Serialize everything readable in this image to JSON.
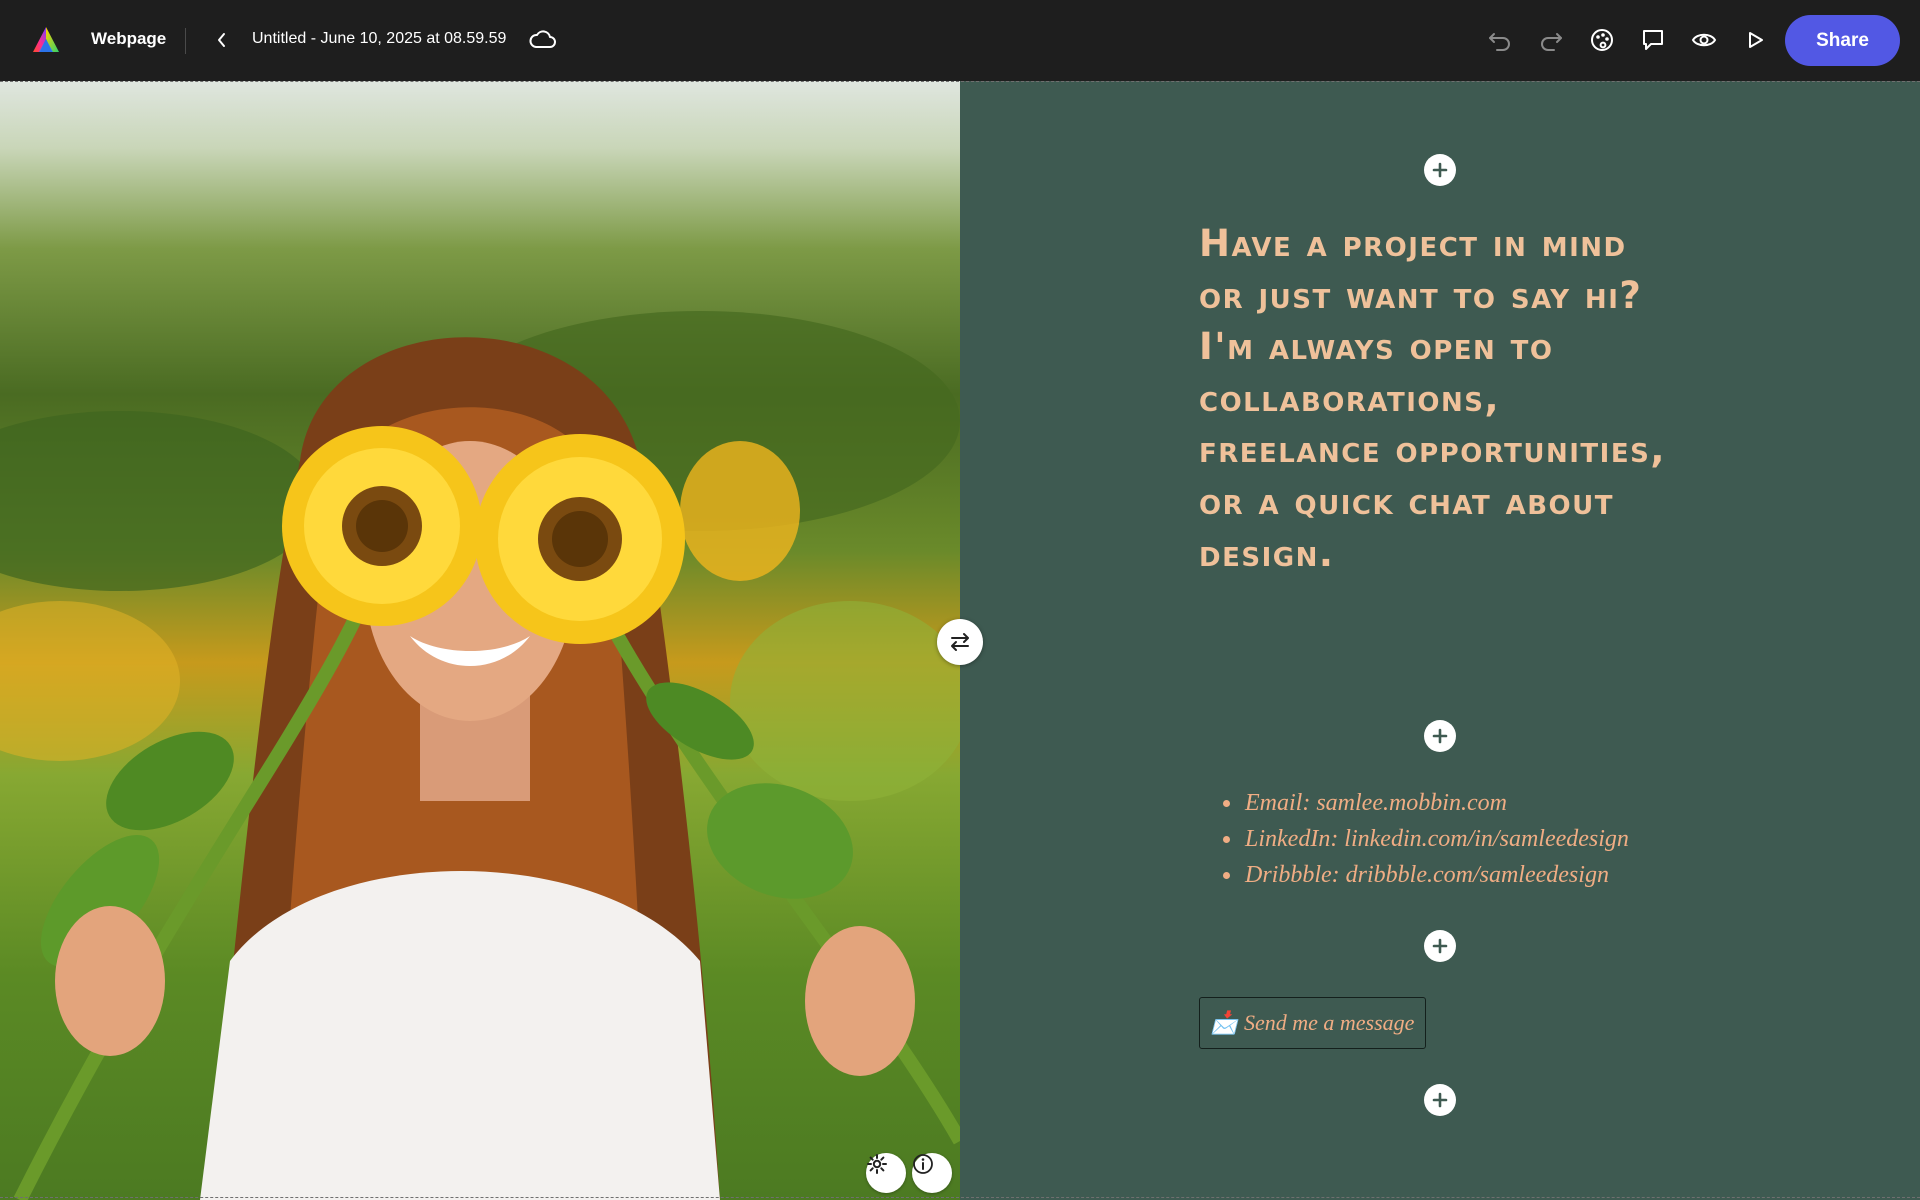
{
  "header": {
    "app_name": "Webpage",
    "doc_title": "Untitled - June 10, 2025 at 08.59.59",
    "share_label": "Share",
    "icons": [
      "adobe-express-logo",
      "back-chevron-icon",
      "cloud-sync-icon",
      "undo-icon",
      "redo-icon",
      "theme-palette-icon",
      "comment-icon",
      "preview-eye-icon",
      "play-icon"
    ]
  },
  "content": {
    "headline": "Have a project in mind or just want to say hi? I'm always open to collaborations, freelance opportunities, or a quick chat about design.",
    "contacts": [
      "Email: samlee.mobbin.com",
      "LinkedIn: linkedin.com/in/samleedesign",
      "Dribbble: dribbble.com/samleedesign"
    ],
    "cta_emoji": "📩",
    "cta_label": "Send me a message"
  },
  "colors": {
    "topbar": "#1e1e1e",
    "share": "#5258e4",
    "panel": "#3e5a51",
    "headline": "#efc19a",
    "accent_text": "#f0ad84"
  }
}
